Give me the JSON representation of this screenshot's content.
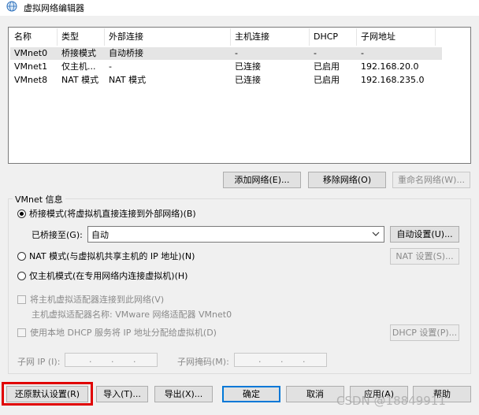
{
  "window": {
    "title": "虚拟网络编辑器"
  },
  "network_list": {
    "columns": [
      "名称",
      "类型",
      "外部连接",
      "主机连接",
      "DHCP",
      "子网地址"
    ],
    "rows": [
      [
        "VMnet0",
        "桥接模式",
        "自动桥接",
        "-",
        "-",
        "-"
      ],
      [
        "VMnet1",
        "仅主机...",
        "-",
        "已连接",
        "已启用",
        "192.168.20.0"
      ],
      [
        "VMnet8",
        "NAT 模式",
        "NAT 模式",
        "已连接",
        "已启用",
        "192.168.235.0"
      ]
    ],
    "selected_row": 0
  },
  "list_buttons": {
    "add": "添加网络(E)...",
    "remove": "移除网络(O)",
    "rename": "重命名网络(W)..."
  },
  "vmnet_info": {
    "group_title": "VMnet 信息",
    "bridged_label": "桥接模式(将虚拟机直接连接到外部网络)(B)",
    "bridged_to_label": "已桥接至(G):",
    "bridged_to_value": "自动",
    "auto_settings": "自动设置(U)...",
    "nat_label": "NAT 模式(与虚拟机共享主机的 IP 地址)(N)",
    "nat_settings": "NAT 设置(S)...",
    "hostonly_label": "仅主机模式(在专用网络内连接虚拟机)(H)",
    "connect_adapter_label": "将主机虚拟适配器连接到此网络(V)",
    "adapter_name_label": "主机虚拟适配器名称: VMware 网络适配器 VMnet0",
    "use_dhcp_label": "使用本地 DHCP 服务将 IP 地址分配给虚拟机(D)",
    "dhcp_settings": "DHCP 设置(P)...",
    "subnet_ip_label": "子网 IP (I):",
    "subnet_mask_label": "子网掩码(M):",
    "ip_dot": "."
  },
  "bottom_buttons": {
    "restore": "还原默认设置(R)",
    "import": "导入(T)...",
    "export": "导出(X)...",
    "ok": "确定",
    "cancel": "取消",
    "apply": "应用(A)",
    "help": "帮助"
  },
  "watermark": "CSDN @18849911",
  "colors": {
    "accent": "#0078d7",
    "highlight": "#e00000",
    "selected_row": "#e5e5e5"
  }
}
